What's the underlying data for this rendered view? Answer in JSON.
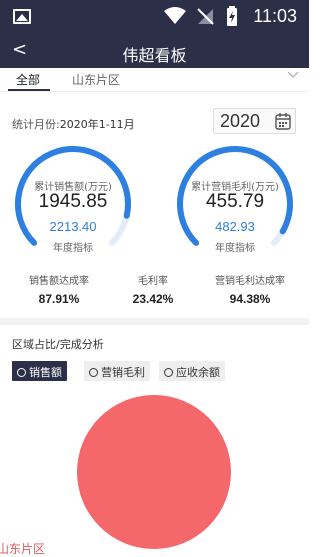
{
  "status_bar": {
    "time": "11:03"
  },
  "header": {
    "back_label": "<",
    "title": "伟超看板"
  },
  "tabs": [
    {
      "label": "全部",
      "active": true
    },
    {
      "label": "山东片区",
      "active": false
    }
  ],
  "filter": {
    "month_label": "统计月份:",
    "month_value": "2020年1-11月",
    "year": "2020"
  },
  "gauges": [
    {
      "title": "累计销售额(万元)",
      "value": "1945.85",
      "target": "2213.40",
      "target_label": "年度指标",
      "progress": 0.8791
    },
    {
      "title": "累计营销毛利(万元)",
      "value": "455.79",
      "target": "482.93",
      "target_label": "年度指标",
      "progress": 0.9438
    }
  ],
  "rates": [
    {
      "label": "销售额达成率",
      "value": "87.91%"
    },
    {
      "label": "毛利率",
      "value": "23.42%"
    },
    {
      "label": "营销毛利达成率",
      "value": "94.38%"
    }
  ],
  "analysis": {
    "title": "区域占比/完成分析",
    "buttons": [
      {
        "label": "销售额",
        "active": true
      },
      {
        "label": "营销毛利",
        "active": false
      },
      {
        "label": "应收余额",
        "active": false
      }
    ]
  },
  "chart_data": {
    "type": "pie",
    "categories": [
      "山东片区"
    ],
    "values": [
      100
    ],
    "colors": [
      "#f4676b"
    ]
  },
  "colors": {
    "header": "#2b2f48",
    "gauge_blue": "#2d7fe0",
    "gauge_track": "#e3ecf8",
    "pie": "#f4676b"
  }
}
